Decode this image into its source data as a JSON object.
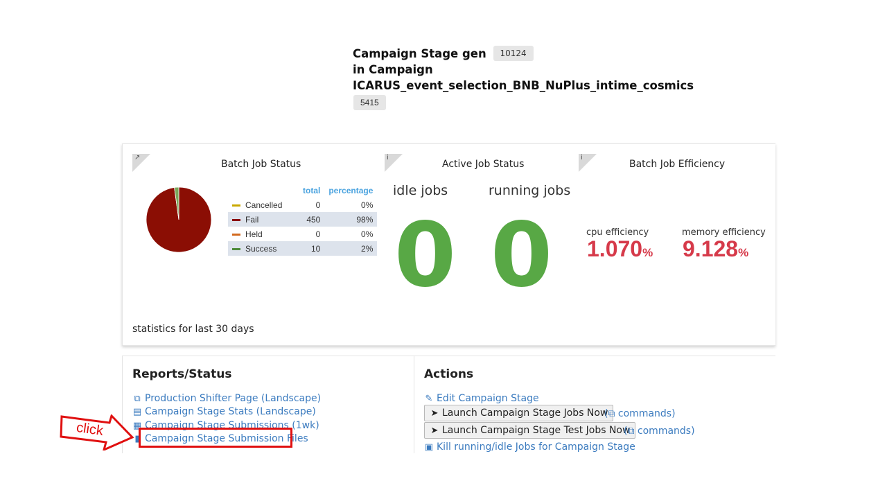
{
  "header": {
    "line1": "Campaign Stage gen",
    "stage_id": "10124",
    "line2": "in Campaign",
    "campaign_name": "ICARUS_event_selection_BNB_NuPlus_intime_cosmics",
    "campaign_id": "5415"
  },
  "batch_status": {
    "title": "Batch Job Status",
    "corner_icon": "external-link-icon",
    "col_total": "total",
    "col_percentage": "percentage",
    "rows": [
      {
        "label": "Cancelled",
        "total": "0",
        "pct": "0%",
        "color": "#c9a800"
      },
      {
        "label": "Fail",
        "total": "450",
        "pct": "98%",
        "color": "#8b0e04"
      },
      {
        "label": "Held",
        "total": "0",
        "pct": "0%",
        "color": "#d2691e"
      },
      {
        "label": "Success",
        "total": "10",
        "pct": "2%",
        "color": "#4e8b3a"
      }
    ],
    "footer": "statistics for last 30 days"
  },
  "chart_data": {
    "type": "pie",
    "categories": [
      "Cancelled",
      "Fail",
      "Held",
      "Success"
    ],
    "values": [
      0,
      450,
      0,
      10
    ],
    "colors": [
      "#c9a800",
      "#8b0e04",
      "#d2691e",
      "#7aa85a"
    ]
  },
  "active_status": {
    "title": "Active Job Status",
    "corner_icon": "info-icon",
    "idle_label": "idle jobs",
    "idle_value": "0",
    "running_label": "running jobs",
    "running_value": "0"
  },
  "efficiency": {
    "title": "Batch Job Efficiency",
    "corner_icon": "info-icon",
    "cpu_label": "cpu efficiency",
    "cpu_value": "1.070",
    "memory_label": "memory efficiency",
    "memory_value": "9.128",
    "unit": "%"
  },
  "reports": {
    "title": "Reports/Status",
    "links": [
      {
        "label": "Production Shifter Page (Landscape)",
        "icon": "external-link-icon"
      },
      {
        "label": "Campaign Stage Stats (Landscape)",
        "icon": "bar-chart-icon"
      },
      {
        "label": "Campaign Stage Submissions (1wk)",
        "icon": "table-icon"
      },
      {
        "label": "Campaign Stage Submission Files",
        "icon": "file-icon"
      }
    ]
  },
  "actions": {
    "title": "Actions",
    "edit_label": "Edit Campaign Stage",
    "launch_label": "Launch Campaign Stage Jobs Now",
    "launch_test_label": "Launch Campaign Stage Test Jobs Now",
    "commands_label": "commands",
    "kill_label": "Kill running/idle Jobs for Campaign Stage"
  },
  "annotation": {
    "arrow_text": "click"
  }
}
